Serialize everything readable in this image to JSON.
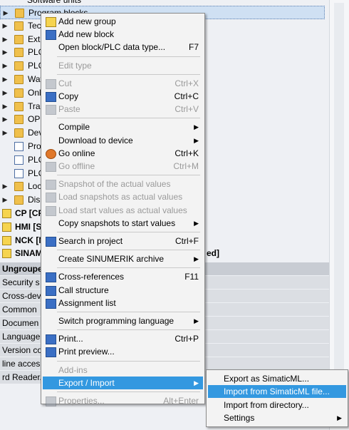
{
  "tree": {
    "top_partial": "Software units",
    "rows": [
      {
        "label": "Program blocks",
        "icon": "folder-icon",
        "expander": true,
        "selected": true
      },
      {
        "label": "Tec",
        "icon": "folder-icon",
        "expander": true
      },
      {
        "label": "Ext",
        "icon": "folder-icon",
        "expander": true
      },
      {
        "label": "PLC",
        "icon": "folder-icon",
        "expander": true
      },
      {
        "label": "PLC",
        "icon": "folder-icon",
        "expander": true
      },
      {
        "label": "Wat",
        "icon": "folder-icon",
        "expander": true
      },
      {
        "label": "Onl",
        "icon": "folder-icon",
        "expander": true
      },
      {
        "label": "Trac",
        "icon": "folder-icon",
        "expander": true
      },
      {
        "label": "OPC",
        "icon": "folder-icon",
        "expander": true
      },
      {
        "label": "Dev",
        "icon": "folder-icon",
        "expander": true
      },
      {
        "label": "Pro",
        "icon": "document-icon",
        "expander": false
      },
      {
        "label": "PLC",
        "icon": "document-icon",
        "expander": false
      },
      {
        "label": "PLC",
        "icon": "document-icon",
        "expander": false
      },
      {
        "label": "Loc",
        "icon": "folder-icon",
        "expander": true
      },
      {
        "label": "Dis",
        "icon": "folder-icon",
        "expander": true
      },
      {
        "label": "CP [CP",
        "icon": "device-icon",
        "expander": false,
        "bold": true
      },
      {
        "label": "HMI [S",
        "icon": "device-icon",
        "expander": false,
        "bold": true
      },
      {
        "label": "NCK [N",
        "icon": "device-icon",
        "expander": false,
        "bold": true
      },
      {
        "label": "SINAM",
        "icon": "device-icon",
        "expander": false,
        "bold": true,
        "suffix": "ed]"
      }
    ],
    "sections": [
      {
        "label": "Ungroupe",
        "header": true
      },
      {
        "label": "Security s"
      },
      {
        "label": "Cross-dev"
      },
      {
        "label": "Common"
      },
      {
        "label": "Documen"
      },
      {
        "label": "Language"
      },
      {
        "label": "Version co"
      },
      {
        "label": "line acces"
      },
      {
        "label": "rd Reader/U"
      }
    ]
  },
  "context_menu": {
    "items": [
      {
        "label": "Add new group",
        "icon": "add-group-icon",
        "enabled": true
      },
      {
        "label": "Add new block",
        "icon": "add-block-icon",
        "enabled": true
      },
      {
        "label": "Open block/PLC data type...",
        "shortcut": "F7",
        "enabled": true
      },
      {
        "sep": true
      },
      {
        "label": "Edit type",
        "enabled": false
      },
      {
        "sep": true
      },
      {
        "label": "Cut",
        "shortcut": "Ctrl+X",
        "icon": "cut-icon",
        "enabled": false
      },
      {
        "label": "Copy",
        "shortcut": "Ctrl+C",
        "icon": "copy-icon",
        "enabled": true
      },
      {
        "label": "Paste",
        "shortcut": "Ctrl+V",
        "icon": "paste-icon",
        "enabled": false
      },
      {
        "sep": true
      },
      {
        "label": "Compile",
        "submenu": true,
        "enabled": true
      },
      {
        "label": "Download to device",
        "submenu": true,
        "enabled": true
      },
      {
        "label": "Go online",
        "shortcut": "Ctrl+K",
        "icon": "go-online-icon",
        "enabled": true
      },
      {
        "label": "Go offline",
        "shortcut": "Ctrl+M",
        "icon": "go-offline-icon",
        "enabled": false
      },
      {
        "sep": true
      },
      {
        "label": "Snapshot of the actual values",
        "icon": "snapshot-icon",
        "enabled": false
      },
      {
        "label": "Load snapshots as actual values",
        "icon": "load-snapshot-icon",
        "enabled": false
      },
      {
        "label": "Load start values as actual values",
        "icon": "load-start-icon",
        "enabled": false
      },
      {
        "label": "Copy snapshots to start values",
        "submenu": true,
        "enabled": true
      },
      {
        "sep": true
      },
      {
        "label": "Search in project",
        "shortcut": "Ctrl+F",
        "icon": "search-icon",
        "enabled": true
      },
      {
        "sep": true
      },
      {
        "label": "Create SINUMERIK archive",
        "submenu": true,
        "enabled": true
      },
      {
        "sep": true
      },
      {
        "label": "Cross-references",
        "shortcut": "F11",
        "icon": "cross-references-icon",
        "enabled": true
      },
      {
        "label": "Call structure",
        "icon": "call-structure-icon",
        "enabled": true
      },
      {
        "label": "Assignment list",
        "icon": "assignment-list-icon",
        "enabled": true
      },
      {
        "sep": true
      },
      {
        "label": "Switch programming language",
        "submenu": true,
        "enabled": true
      },
      {
        "sep": true
      },
      {
        "label": "Print...",
        "shortcut": "Ctrl+P",
        "icon": "print-icon",
        "enabled": true
      },
      {
        "label": "Print preview...",
        "icon": "print-preview-icon",
        "enabled": true
      },
      {
        "sep": true
      },
      {
        "label": "Add-ins",
        "enabled": false
      },
      {
        "label": "Export / Import",
        "submenu": true,
        "enabled": true,
        "highlight": true
      },
      {
        "sep": true
      },
      {
        "label": "Properties...",
        "shortcut": "Alt+Enter",
        "icon": "properties-icon",
        "enabled": false
      }
    ]
  },
  "submenu": {
    "items": [
      {
        "label": "Export as SimaticML..."
      },
      {
        "label": "Import from SimaticML file...",
        "highlight": true
      },
      {
        "label": "Import from directory..."
      },
      {
        "label": "Settings",
        "submenu": true
      }
    ]
  },
  "colors": {
    "highlight": "#3398e0",
    "disabled_text": "#9a9a9a",
    "menu_bg": "#f3f3f3"
  }
}
